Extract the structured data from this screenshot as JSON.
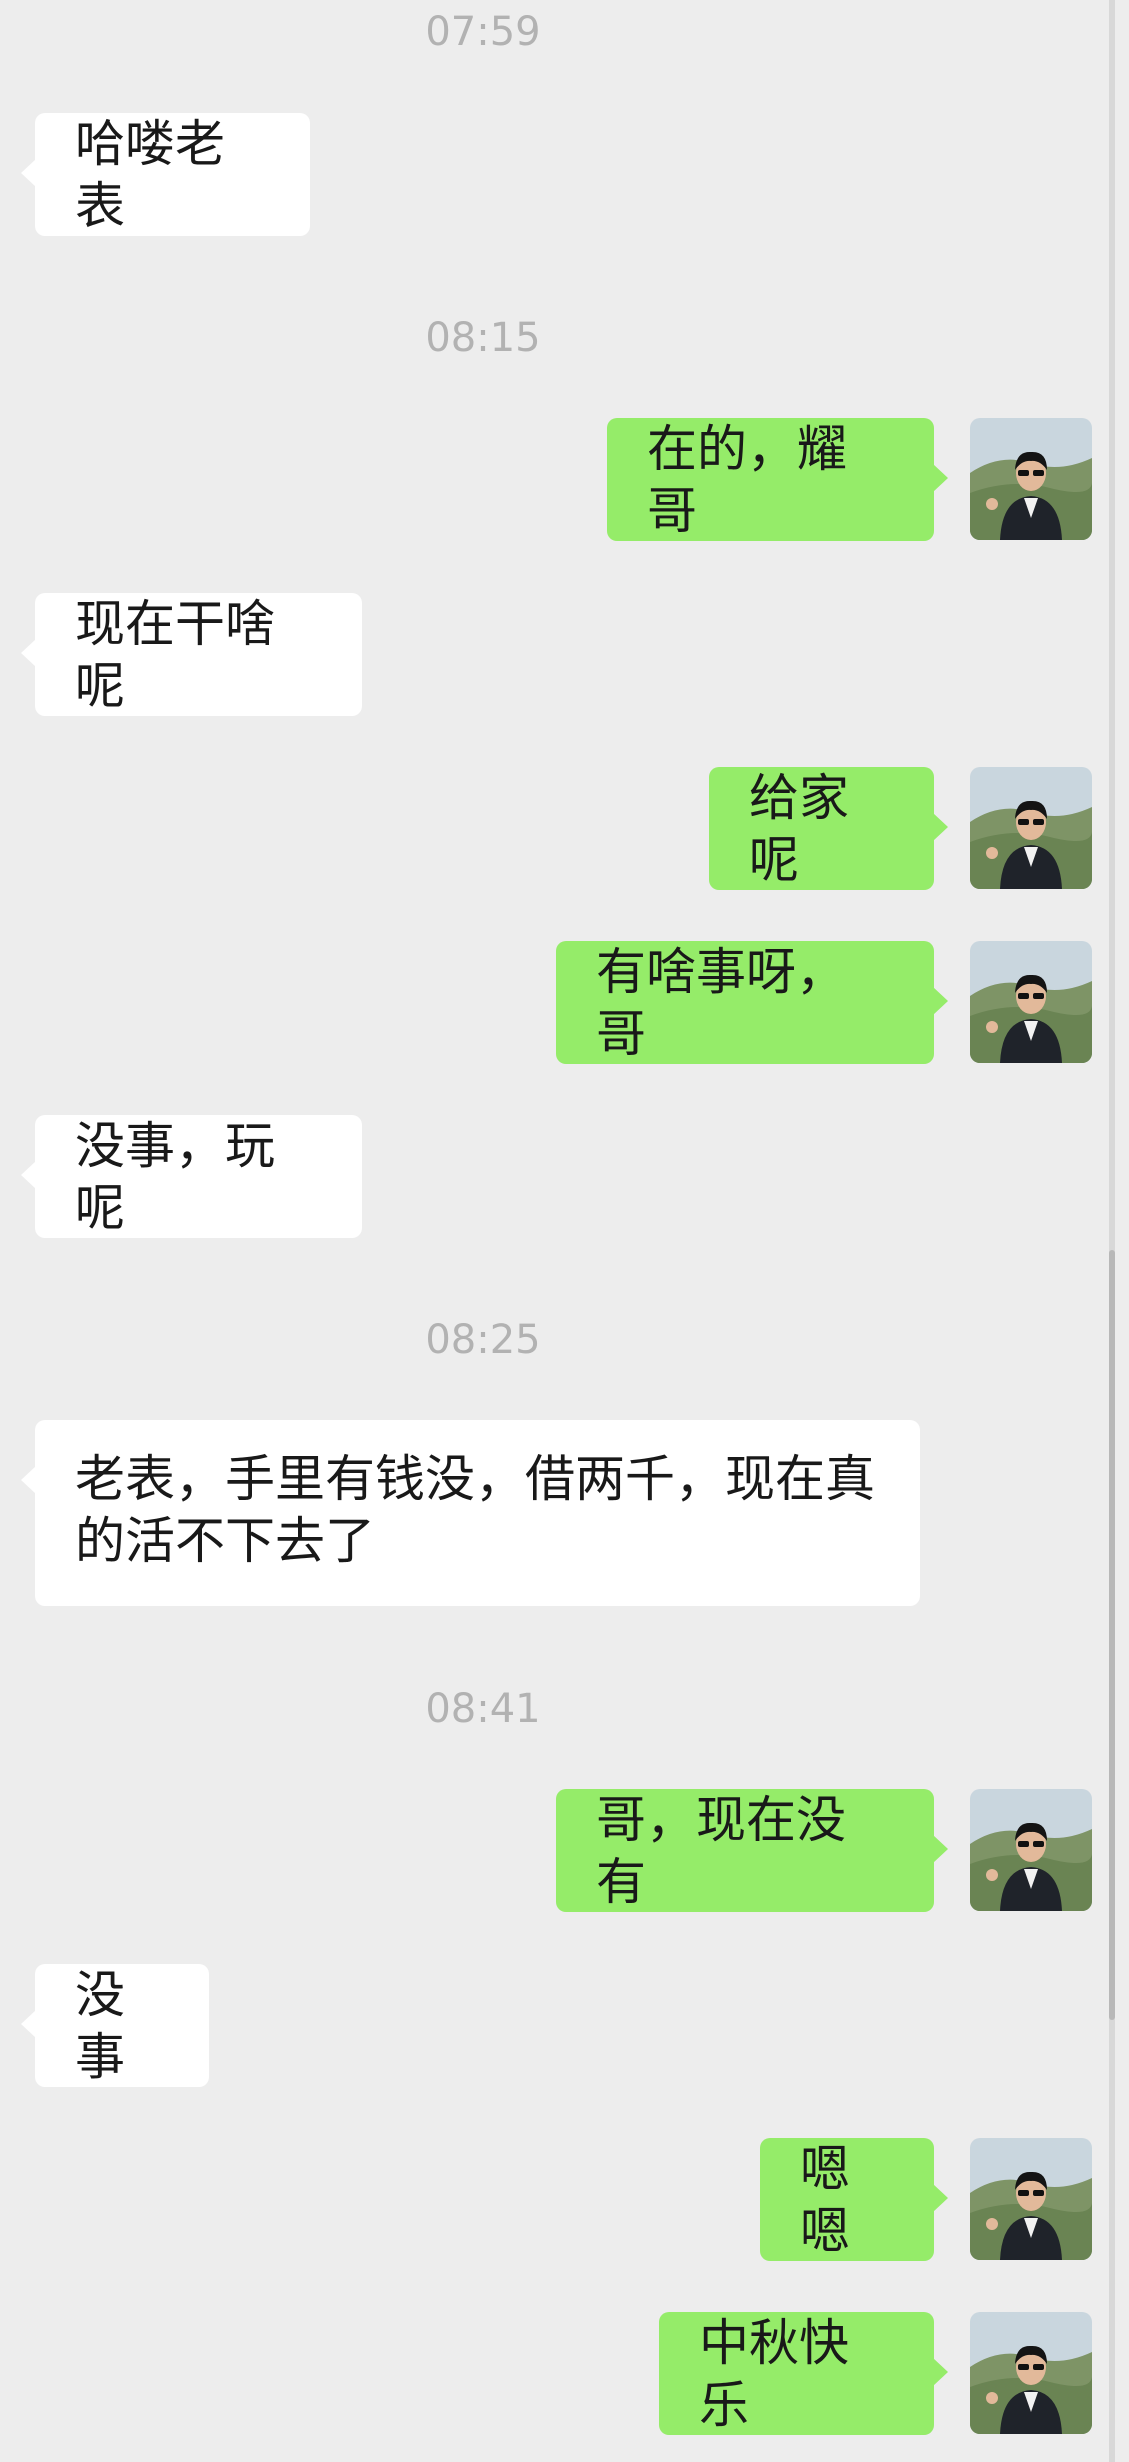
{
  "chat": {
    "timestamps": [
      "07:59",
      "08:15",
      "08:25",
      "08:41"
    ],
    "messages": [
      {
        "side": "in",
        "text": "哈喽老表"
      },
      {
        "side": "out",
        "text": "在的，耀哥"
      },
      {
        "side": "in",
        "text": "现在干啥呢"
      },
      {
        "side": "out",
        "text": "给家呢"
      },
      {
        "side": "out",
        "text": "有啥事呀，哥"
      },
      {
        "side": "in",
        "text": "没事，玩呢"
      },
      {
        "side": "in",
        "text": "老表，手里有钱没，借两千，现在真的活不下去了"
      },
      {
        "side": "out",
        "text": "哥，现在没有"
      },
      {
        "side": "in",
        "text": "没事"
      },
      {
        "side": "out",
        "text": "嗯嗯"
      },
      {
        "side": "out",
        "text": "中秋快乐"
      }
    ]
  },
  "colors": {
    "background": "#ededed",
    "incoming_bubble": "#ffffff",
    "outgoing_bubble": "#95ec69",
    "timestamp_text": "#b2b2b2"
  },
  "icons": {
    "avatar": "user-avatar-photo"
  }
}
